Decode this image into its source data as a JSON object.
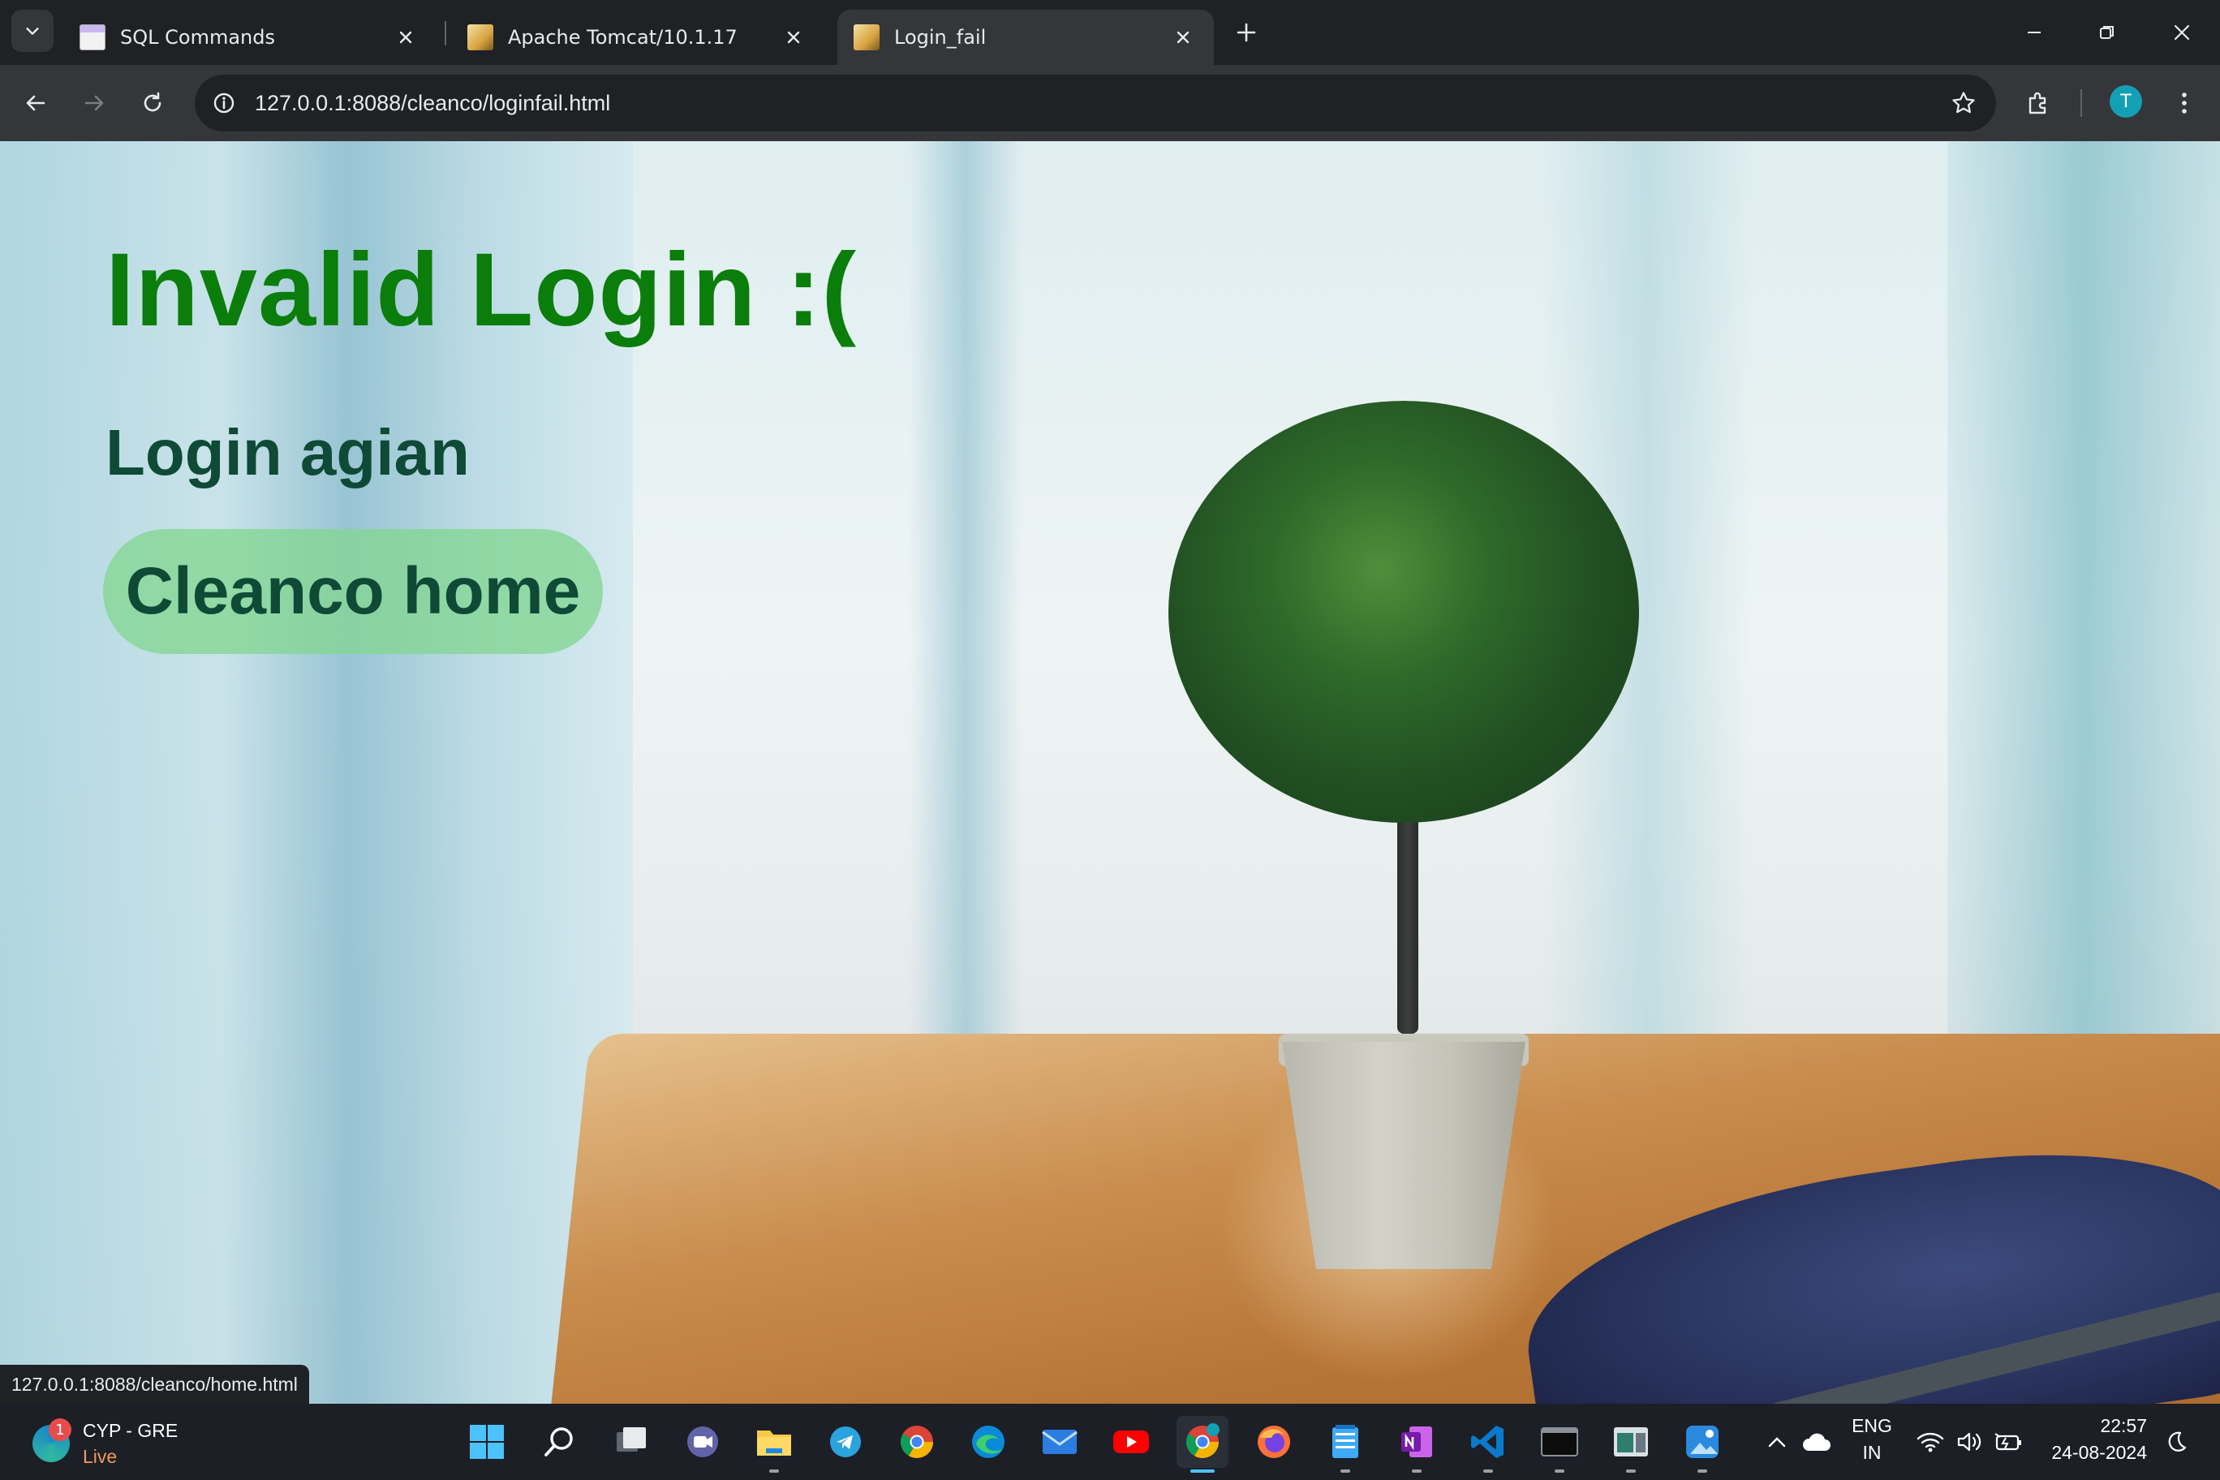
{
  "browser": {
    "tabs": [
      {
        "title": "SQL Commands",
        "favicon": "window-favicon",
        "active": false
      },
      {
        "title": "Apache Tomcat/10.1.17",
        "favicon": "tomcat-favicon",
        "active": false
      },
      {
        "title": "Login_fail",
        "favicon": "tomcat-favicon",
        "active": true
      }
    ],
    "address": "127.0.0.1:8088/cleanco/loginfail.html",
    "profile_initial": "T",
    "status_url": "127.0.0.1:8088/cleanco/home.html"
  },
  "page": {
    "heading": "Invalid Login :(",
    "subheading": "Login agian",
    "home_button": "Cleanco home",
    "heading_color": "#0b7d0b",
    "button_color": "#83d692"
  },
  "taskbar": {
    "weather": {
      "badge": "1",
      "location": "CYP - GRE",
      "status": "Live"
    },
    "apps": [
      "start-icon",
      "search-icon",
      "task-view-icon",
      "teams-icon",
      "file-explorer-icon",
      "telegram-icon",
      "chrome-icon",
      "edge-icon",
      "mail-icon",
      "youtube-icon",
      "chrome-active-icon",
      "firefox-icon",
      "notepad-icon",
      "onenote-icon",
      "vscode-icon",
      "terminal-icon",
      "app-icon",
      "photos-icon"
    ],
    "language": {
      "line1": "ENG",
      "line2": "IN"
    },
    "clock": {
      "time": "22:57",
      "date": "24-08-2024"
    }
  }
}
